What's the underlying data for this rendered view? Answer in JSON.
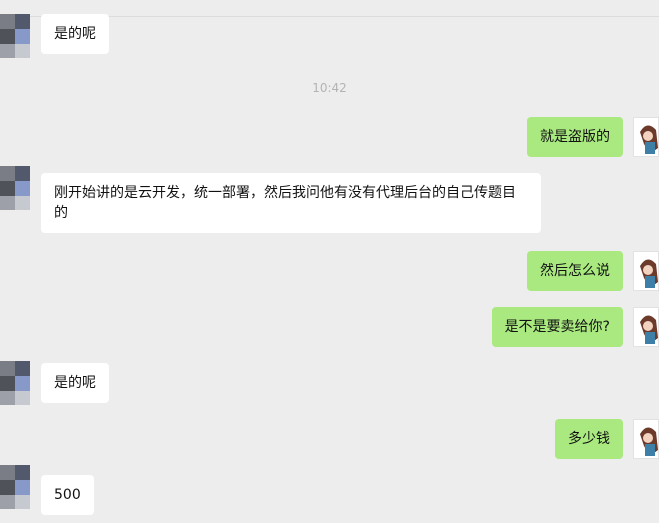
{
  "chat": {
    "timestamp": "10:42",
    "messages": [
      {
        "side": "in",
        "text": "是的呢"
      },
      {
        "side": "out",
        "text": "就是盗版的"
      },
      {
        "side": "in",
        "text": "刚开始讲的是云开发，统一部署，然后我问他有没有代理后台的自己传题目的"
      },
      {
        "side": "out",
        "text": "然后怎么说"
      },
      {
        "side": "out",
        "text": "是不是要卖给你?"
      },
      {
        "side": "in",
        "text": "是的呢"
      },
      {
        "side": "out",
        "text": "多少钱"
      },
      {
        "side": "in",
        "text": "500"
      }
    ]
  },
  "colors": {
    "background": "#ededed",
    "incoming_bubble": "#ffffff",
    "outgoing_bubble": "#a9e97f"
  },
  "icons": {
    "contact_avatar": "pixelated-avatar-icon",
    "self_avatar": "anime-girl-avatar-icon"
  }
}
